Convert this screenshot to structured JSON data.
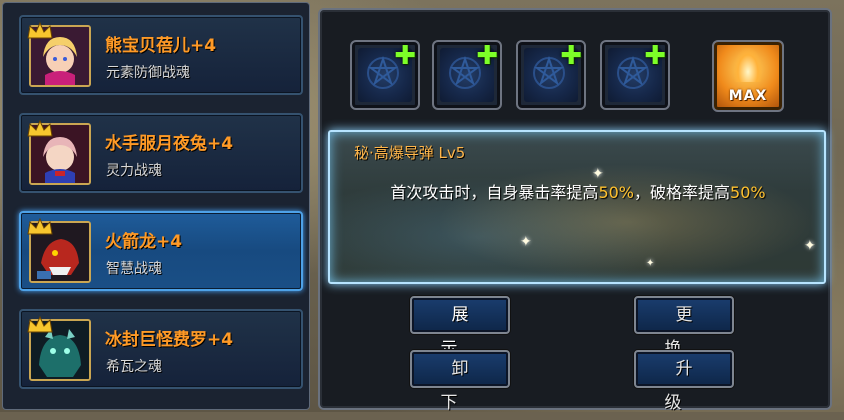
{
  "spirit_list": [
    {
      "name": "熊宝贝蓓儿+4",
      "type": "元素防御战魂",
      "active": false
    },
    {
      "name": "水手服月夜兔+4",
      "type": "灵力战魂",
      "active": false
    },
    {
      "name": "火箭龙+4",
      "type": "智慧战魂",
      "active": true
    },
    {
      "name": "冰封巨怪费罗+4",
      "type": "希瓦之魂",
      "active": false
    }
  ],
  "slots": {
    "empty_count": 4,
    "max_label": "MAX"
  },
  "skill": {
    "title": "秘·高爆导弹 Lv5",
    "desc_part1": "首次攻击时，自身暴击率提高",
    "value1": "50%",
    "desc_part2": "，破格率提高",
    "value2": "50%"
  },
  "buttons": {
    "show": "展示",
    "replace": "更换",
    "unequip": "卸下",
    "upgrade": "升级"
  },
  "colors": {
    "name_text": "#ff9a26",
    "highlight_value": "#ffc12e",
    "active_card": "#1f5c9a",
    "plus_icon": "#7dff28"
  }
}
